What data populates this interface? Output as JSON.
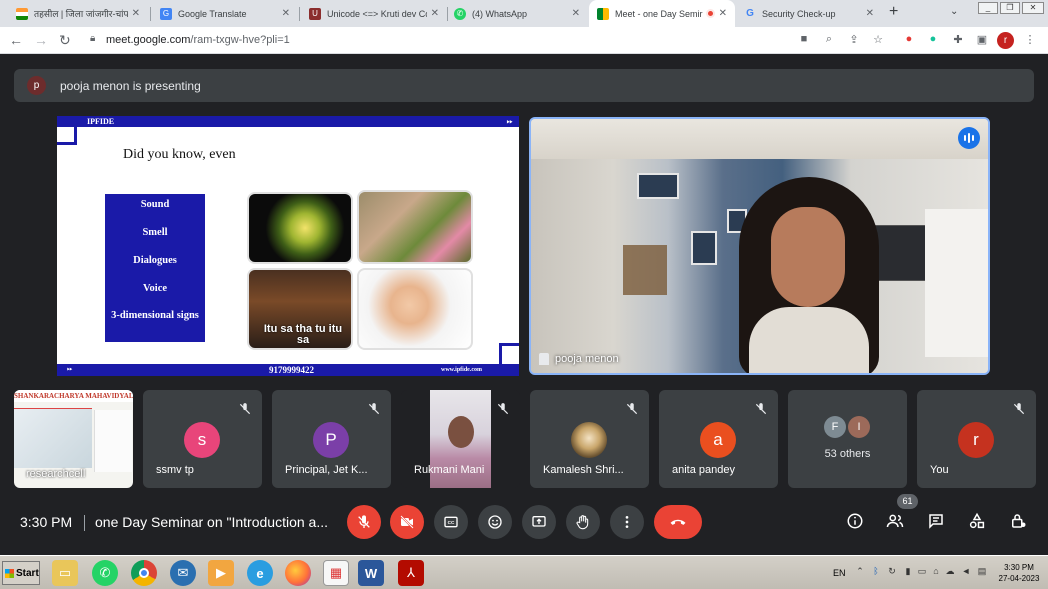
{
  "browser": {
    "tabs": [
      {
        "label": "तहसील | जिला जांजगीर-चांपा",
        "favicon": "flag-india-icon",
        "active": false
      },
      {
        "label": "Google Translate",
        "favicon": "google-translate-icon",
        "active": false
      },
      {
        "label": "Unicode <=> Kruti dev Co",
        "favicon": "unicode-icon",
        "active": false
      },
      {
        "label": "(4) WhatsApp",
        "favicon": "whatsapp-icon",
        "active": false
      },
      {
        "label": "Meet - one Day Semir",
        "favicon": "meet-icon",
        "active": true
      },
      {
        "label": "Security Check-up",
        "favicon": "google-icon",
        "active": false
      }
    ],
    "url_host": "meet.google.com",
    "url_path": "/ram-txgw-hve?pli=1",
    "profile_initial": "r"
  },
  "presenting": {
    "avatar_letter": "p",
    "text": "pooja menon is presenting"
  },
  "slide": {
    "brand": "IPFIDE",
    "heading": "Did you know, even",
    "items": [
      "Sound",
      "Smell",
      "Dialogues",
      "Voice",
      "3-dimensional signs"
    ],
    "image_caption": "Itu sa tha tu itu sa",
    "phone": "9179999422",
    "website": "www.ipfide.com"
  },
  "presenter": {
    "name": "pooja menon"
  },
  "participants": [
    {
      "name": "",
      "type": "screen",
      "shared_text": "SHANKARACHARYA MAHAVIDYAL",
      "caption": "researchcell"
    },
    {
      "name": "ssmv tp",
      "initial": "s",
      "color": "#e8457a"
    },
    {
      "name": "Principal, Jet K...",
      "initial": "P",
      "color": "#7b3fa8"
    },
    {
      "name": "Rukmani Mani",
      "type": "video"
    },
    {
      "name": "Kamalesh Shri...",
      "type": "photo"
    },
    {
      "name": "anita pandey",
      "initial": "a",
      "color": "#ea4f1f"
    },
    {
      "name": "53 others",
      "initials": [
        "F",
        "I"
      ]
    },
    {
      "name": "You",
      "initial": "r",
      "color": "#c5321f"
    }
  ],
  "controls": {
    "time": "3:30 PM",
    "meeting_name": "one Day Seminar on \"Introduction a...",
    "participant_count": "61"
  },
  "taskbar": {
    "start_label": "Start",
    "language": "EN",
    "time": "3:30 PM",
    "date": "27-04-2023"
  }
}
